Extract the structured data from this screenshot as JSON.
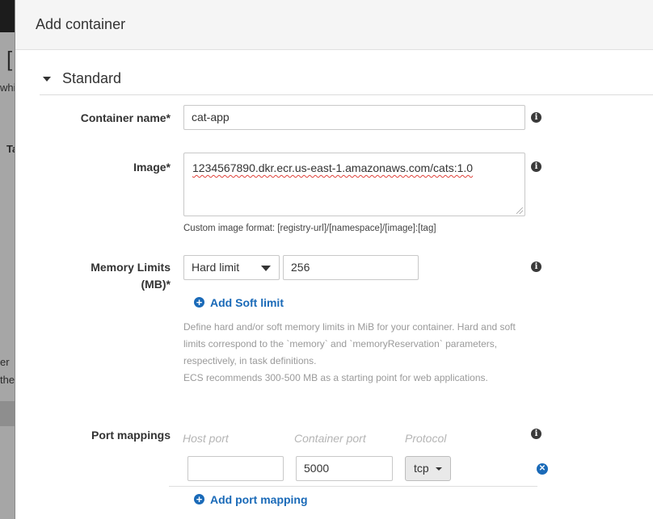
{
  "background_page": {
    "fragments": [
      "[",
      "whi",
      "Ta",
      "er",
      "the"
    ]
  },
  "modal": {
    "title": "Add container",
    "section_title": "Standard",
    "container_name": {
      "label": "Container name*",
      "value": "cat-app"
    },
    "image": {
      "label": "Image*",
      "value": "1234567890.dkr.ecr.us-east-1.amazonaws.com/cats:1.0",
      "hint": "Custom image format: [registry-url]/[namespace]/[image]:[tag]"
    },
    "memory": {
      "label_line1": "Memory Limits",
      "label_line2": "(MB)*",
      "limit_type": "Hard limit",
      "value": "256",
      "add_soft_limit": "Add Soft limit",
      "help_lines": [
        "Define hard and/or soft memory limits in MiB for your container. Hard and soft",
        "limits correspond to the `memory` and `memoryReservation` parameters,",
        "respectively, in task definitions.",
        "ECS recommends 300-500 MB as a starting point for web applications."
      ]
    },
    "port_mappings": {
      "label": "Port mappings",
      "columns": [
        "Host port",
        "Container port",
        "Protocol"
      ],
      "rows": [
        {
          "host_port": "",
          "container_port": "5000",
          "protocol": "tcp"
        }
      ],
      "add_label": "Add port mapping"
    }
  },
  "colors": {
    "link": "#1a6ab8",
    "header_bg": "#f5f5f5",
    "overlay": "#555555"
  },
  "icons": {
    "info": "info-icon",
    "plus": "plus-circle-icon",
    "remove": "remove-circle-icon",
    "caret": "caret-down-icon"
  }
}
